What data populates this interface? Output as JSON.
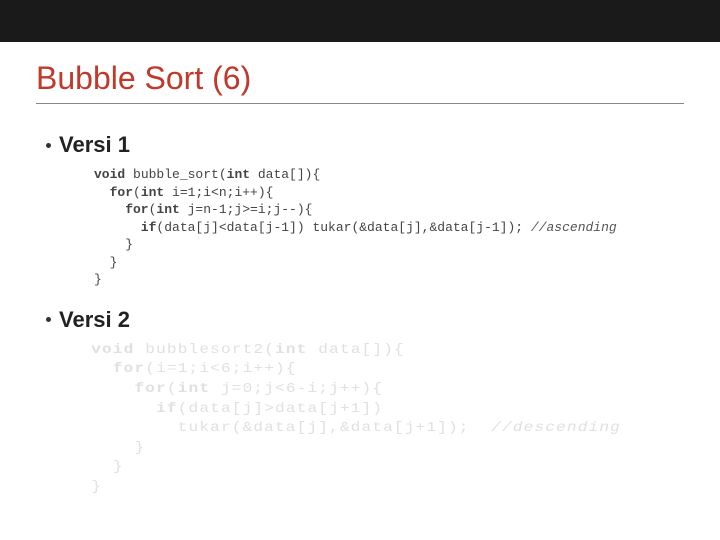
{
  "slide": {
    "title": "Bubble Sort (6)",
    "bullet1": "Versi 1",
    "bullet2": "Versi 2",
    "code1": {
      "l1a": "void",
      "l1b": " bubble_sort(",
      "l1c": "int",
      "l1d": " data[]){",
      "l2a": "  for",
      "l2b": "(",
      "l2c": "int",
      "l2d": " i=1;i<n;i++){",
      "l3a": "    for",
      "l3b": "(",
      "l3c": "int",
      "l3d": " j=n-1;j>=i;j--){",
      "l4a": "      if",
      "l4b": "(data[j]<data[j-1]) tukar(&data[j],&data[j-1]); ",
      "l4c": "//ascending",
      "l5": "    }",
      "l6": "  }",
      "l7": "}"
    },
    "code2": {
      "l1a": "void",
      "l1b": " bubblesort2(",
      "l1c": "int",
      "l1d": " data[]){",
      "l2a": "  for",
      "l2b": "(i=1;i<6;i++){",
      "l3a": "    for",
      "l3b": "(",
      "l3c": "int",
      "l3d": " j=0;j<6-i;j++){",
      "l4a": "      if",
      "l4b": "(data[j]>data[j+1])",
      "l5": "        tukar(&data[j],&data[j+1]);  ",
      "l5c": "//descending",
      "l6": "    }",
      "l7": "  }",
      "l8": "}"
    }
  }
}
